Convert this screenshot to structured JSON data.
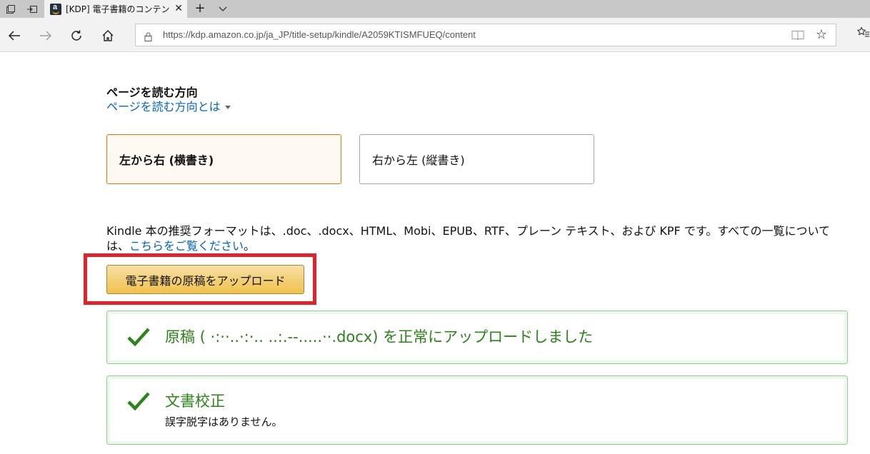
{
  "browser": {
    "tab_title": "[KDP] 電子書籍のコンテン",
    "url": "https://kdp.amazon.co.jp/ja_JP/title-setup/kindle/A2059KTISMFUEQ/content"
  },
  "reading_direction": {
    "title": "ページを読む方向",
    "help_link": "ページを読む方向とは",
    "options": [
      {
        "label": "左から右 (横書き)",
        "selected": true
      },
      {
        "label": "右から左 (縦書き)",
        "selected": false
      }
    ]
  },
  "format_info": {
    "text": "Kindle 本の推奨フォーマットは、.doc、.docx、HTML、Mobi、EPUB、RTF、プレーン テキスト、および KPF です。すべての一覧については、",
    "link": "こちらをご覧ください",
    "suffix": "。"
  },
  "upload": {
    "button_label": "電子書籍の原稿をアップロード"
  },
  "alerts": [
    {
      "message": "原稿 ( ·:··..·:·.. ..:.--.....··.docx) を正常にアップロードしました",
      "detail": ""
    },
    {
      "message": "文書校正",
      "detail": "誤字脱字はありません。"
    }
  ],
  "colors": {
    "link": "#0066c0",
    "selected_border": "#e77600",
    "button": "#f0c14b",
    "success_text": "#2b8319",
    "success_border": "#8ad186",
    "highlight": "#e3222b"
  }
}
